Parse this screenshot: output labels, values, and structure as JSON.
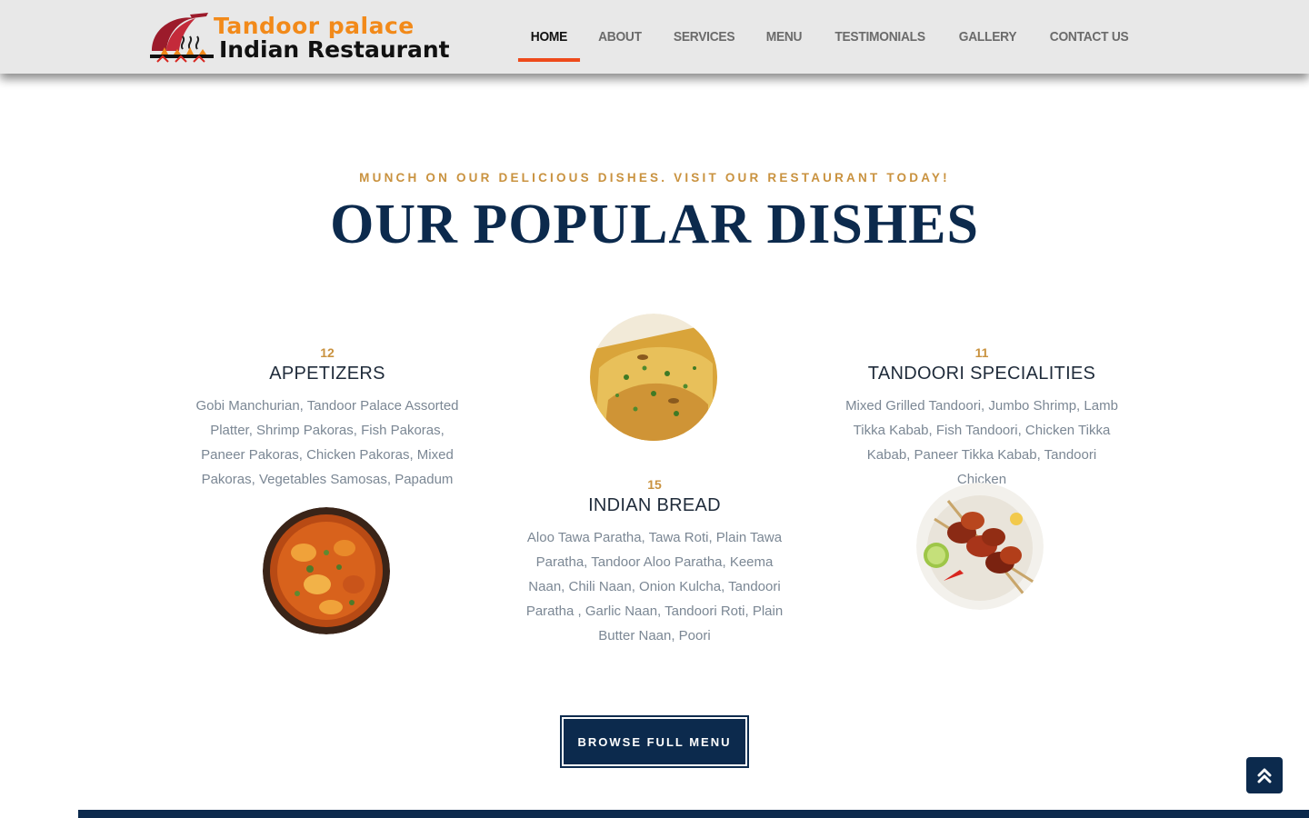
{
  "brand": {
    "line1": "Tandoor palace",
    "line2": "Indian Restaurant",
    "logo_icon": "cloche-flame-icon",
    "accent_color": "#f28a1a"
  },
  "nav": {
    "items": [
      {
        "label": "HOME",
        "active": true
      },
      {
        "label": "ABOUT",
        "active": false
      },
      {
        "label": "SERVICES",
        "active": false
      },
      {
        "label": "MENU",
        "active": false
      },
      {
        "label": "TESTIMONIALS",
        "active": false
      },
      {
        "label": "GALLERY",
        "active": false
      },
      {
        "label": "CONTACT US",
        "active": false
      }
    ],
    "active_underline_color": "#ee4a1b"
  },
  "section": {
    "tagline": "MUNCH ON OUR DELICIOUS DISHES. VISIT OUR RESTAURANT TODAY!",
    "title": "OUR POPULAR DISHES",
    "title_color": "#0c2a4d",
    "tagline_color": "#c9923f"
  },
  "dishes": [
    {
      "count": "12",
      "title": "APPETIZERS",
      "description": "Gobi Manchurian, Tandoor Palace Assorted Platter, Shrimp Pakoras, Fish Pakoras, Paneer Pakoras, Chicken Pakoras, Mixed Pakoras, Vegetables Samosas, Papadum",
      "image": "curry-dish-photo"
    },
    {
      "count": "15",
      "title": "INDIAN BREAD",
      "description": "Aloo Tawa Paratha, Tawa Roti, Plain Tawa Paratha, Tandoor Aloo Paratha, Keema Naan, Chili Naan, Onion Kulcha, Tandoori Paratha , Garlic Naan, Tandoori Roti, Plain Butter Naan, Poori",
      "image": "naan-bread-photo"
    },
    {
      "count": "11",
      "title": "TANDOORI SPECIALITIES",
      "description": "Mixed Grilled Tandoori, Jumbo Shrimp, Lamb Tikka Kabab, Fish Tandoori, Chicken Tikka Kabab, Paneer Tikka Kabab, Tandoori Chicken",
      "image": "tandoori-skewers-photo"
    }
  ],
  "cta": {
    "label": "BROWSE FULL MENU"
  },
  "scroll_top": {
    "icon": "double-chevron-up-icon"
  }
}
